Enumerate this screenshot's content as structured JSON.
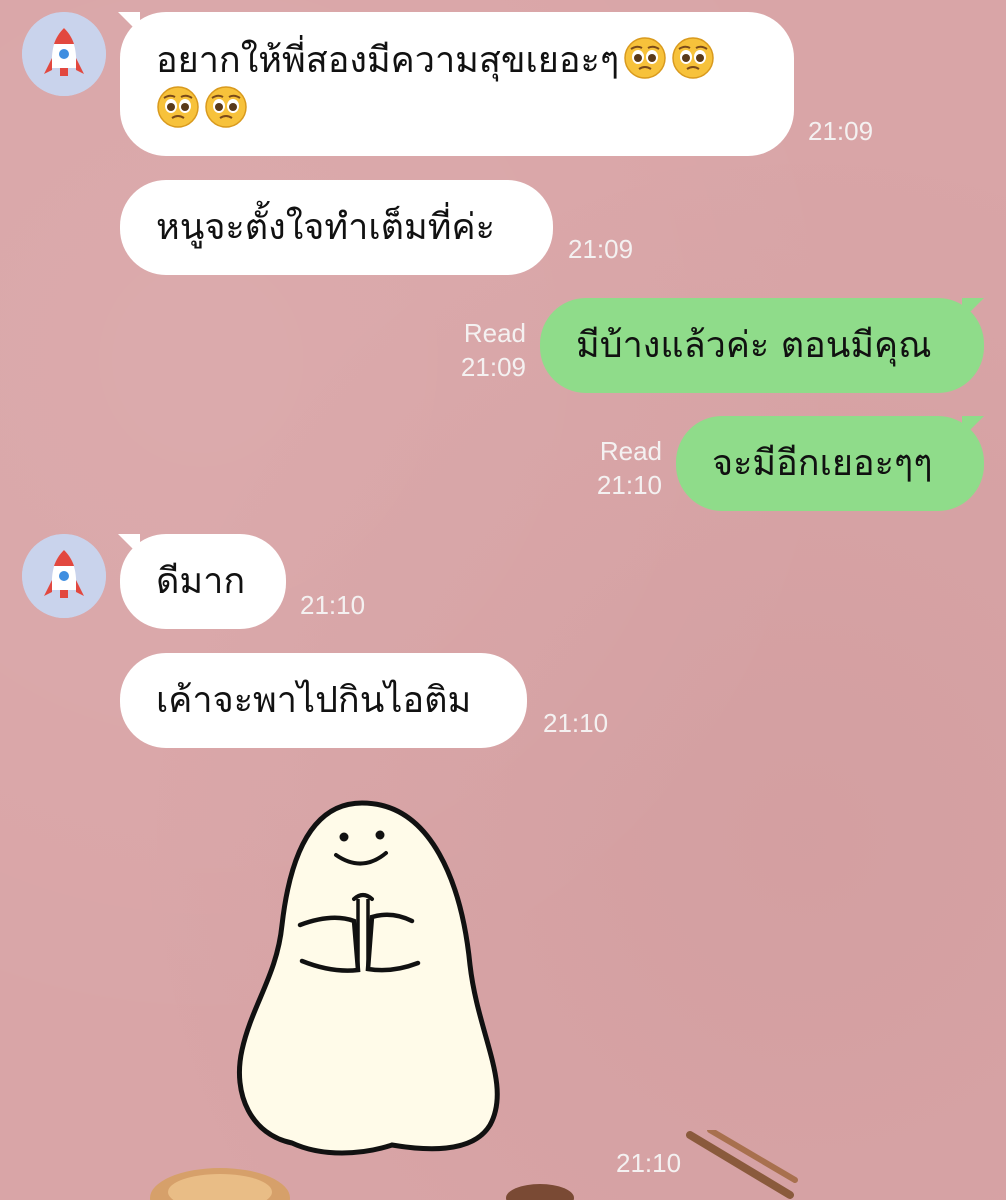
{
  "colors": {
    "background": "#d9a5a7",
    "incoming_bubble": "#ffffff",
    "outgoing_bubble": "#8fdc8a",
    "meta_text": "#f4f1f1"
  },
  "messages": [
    {
      "direction": "in",
      "text_line1": "อยากให้พี่สองมีความสุขเยอะๆ",
      "text_line2": "",
      "emoji": "pleading-face",
      "emoji_count_line1": 2,
      "emoji_count_line2": 2,
      "time": "21:09"
    },
    {
      "direction": "in",
      "text": "หนูจะตั้งใจทำเต็มที่ค่ะ",
      "time": "21:09"
    },
    {
      "direction": "out",
      "text": "มีบ้างแล้วค่ะ ตอนมีคุณ",
      "status": "Read",
      "time": "21:09"
    },
    {
      "direction": "out",
      "text": "จะมีอีกเยอะๆๆ",
      "status": "Read",
      "time": "21:10"
    },
    {
      "direction": "in",
      "text": "ดีมาก",
      "time": "21:10"
    },
    {
      "direction": "in",
      "text": "เค้าจะพาไปกินไอติม",
      "time": "21:10"
    },
    {
      "direction": "in",
      "type": "sticker",
      "sticker": "ghost-praying-sticker",
      "time": "21:10"
    }
  ],
  "avatar": {
    "icon": "rocket-icon"
  }
}
